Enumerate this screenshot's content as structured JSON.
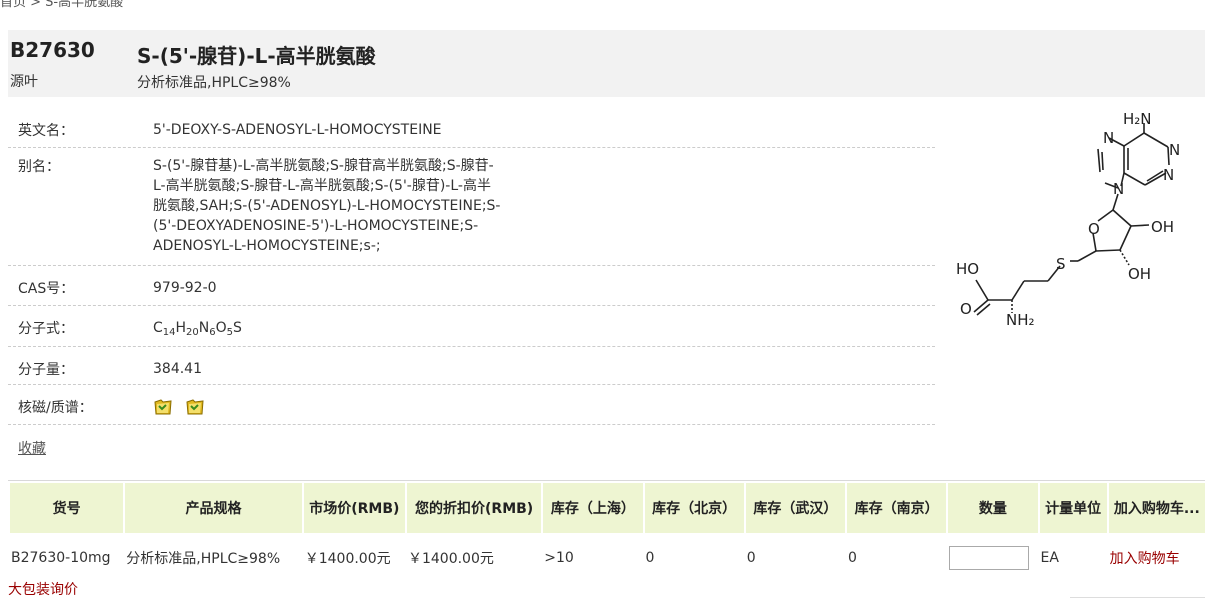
{
  "breadcrumb": "首页 > S-高半胱氨酸",
  "product": {
    "code": "B27630",
    "brand": "源叶",
    "name": "S-(5'-腺苷)-L-高半胱氨酸",
    "grade": "分析标准品,HPLC≥98%"
  },
  "properties": {
    "english_name_label": "英文名：",
    "english_name": "5'-DEOXY-S-ADENOSYL-L-HOMOCYSTEINE",
    "alias_label": "别名：",
    "alias_lines": [
      "S-(5'-腺苷基)-L-高半胱氨酸;S-腺苷高半胱氨酸;S-腺苷-",
      "L-高半胱氨酸;S-腺苷-L-高半胱氨酸;S-(5'-腺苷)-L-高半",
      "胱氨酸,SAH;S-(5'-ADENOSYL)-L-HOMOCYSTEINE;S-",
      "(5'-DEOXYADENOSINE-5')-L-HOMOCYSTEINE;S-",
      "ADENOSYL-L-HOMOCYSTEINE;s-;"
    ],
    "cas_label": "CAS号：",
    "cas": "979-92-0",
    "formula_label": "分子式：",
    "formula_parts": {
      "c": "C",
      "c_n": "14",
      "h": "H",
      "h_n": "20",
      "n": "N",
      "n_n": "6",
      "o": "O",
      "o_n": "5",
      "s": "S"
    },
    "mw_label": "分子量：",
    "mw": "384.41",
    "nmr_label": "核磁/质谱：",
    "nmr_icons": [
      "file-icon",
      "file-icon"
    ]
  },
  "favorite_label": "收藏",
  "structure_labels": {
    "nh2_top": "H₂N",
    "n1": "N",
    "n2": "N",
    "n3": "N",
    "n4": "N",
    "o_ring": "O",
    "oh1": "OH",
    "oh2": "OH",
    "s": "S",
    "ho": "HO",
    "o_acid": "O",
    "nh2_bottom": "NH₂"
  },
  "table": {
    "headers": [
      "货号",
      "产品规格",
      "市场价(RMB)",
      "您的折扣价(RMB)",
      "库存（上海）",
      "库存（北京）",
      "库存（武汉）",
      "库存（南京）",
      "数量",
      "计量单位",
      "加入购物车..."
    ],
    "row": {
      "sku": "B27630-10mg",
      "spec": "分析标准品,HPLC≥98%",
      "market_price": "￥1400.00元",
      "discount_price": "￥1400.00元",
      "stock_shanghai": ">10",
      "stock_beijing": "0",
      "stock_wuhan": "0",
      "stock_nanjing": "0",
      "qty": "",
      "unit": "EA",
      "cart_label": "加入购物车"
    }
  },
  "bulk_inquiry": "大包装询价",
  "colors": {
    "header_bg": "#f2f2f2",
    "table_header_bg": "#eef5d2",
    "link_red": "#990000"
  }
}
